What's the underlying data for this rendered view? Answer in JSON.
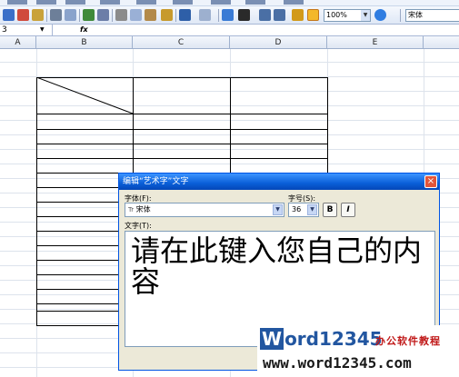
{
  "toolbar": {
    "zoom": "100%",
    "font_name": "宋体"
  },
  "formula_bar": {
    "name_box": "3",
    "fx_label": "fx"
  },
  "column_headers": [
    "A",
    "B",
    "C",
    "D",
    "E"
  ],
  "dialog": {
    "title": "编辑“艺术字”文字",
    "font_label": "字体(F):",
    "font_value": "宋体",
    "size_label": "字号(S):",
    "size_value": "36",
    "bold_label": "B",
    "italic_label": "I",
    "text_label": "文字(T):",
    "text_content": "请在此键入您自己的内容",
    "close_glyph": "×"
  },
  "watermark": {
    "logo_first": "W",
    "logo_rest": "ord12345",
    "tagline": "办公软件教程",
    "url": "www.word12345.com"
  },
  "colors": {
    "title_bar": "#0a5fd8",
    "dialog_bg": "#ece9d8",
    "watermark_blue": "#2256a0",
    "watermark_red": "#c01818"
  },
  "icons": [
    "save-icon",
    "print-icon",
    "preview-icon",
    "spelling-icon",
    "cut-icon",
    "copy-icon",
    "paste-icon",
    "undo-icon",
    "redo-icon",
    "hyperlink-icon",
    "autosum-icon",
    "sort-asc-icon",
    "sort-desc-icon",
    "chart-icon",
    "drawing-icon",
    "help-icon"
  ]
}
